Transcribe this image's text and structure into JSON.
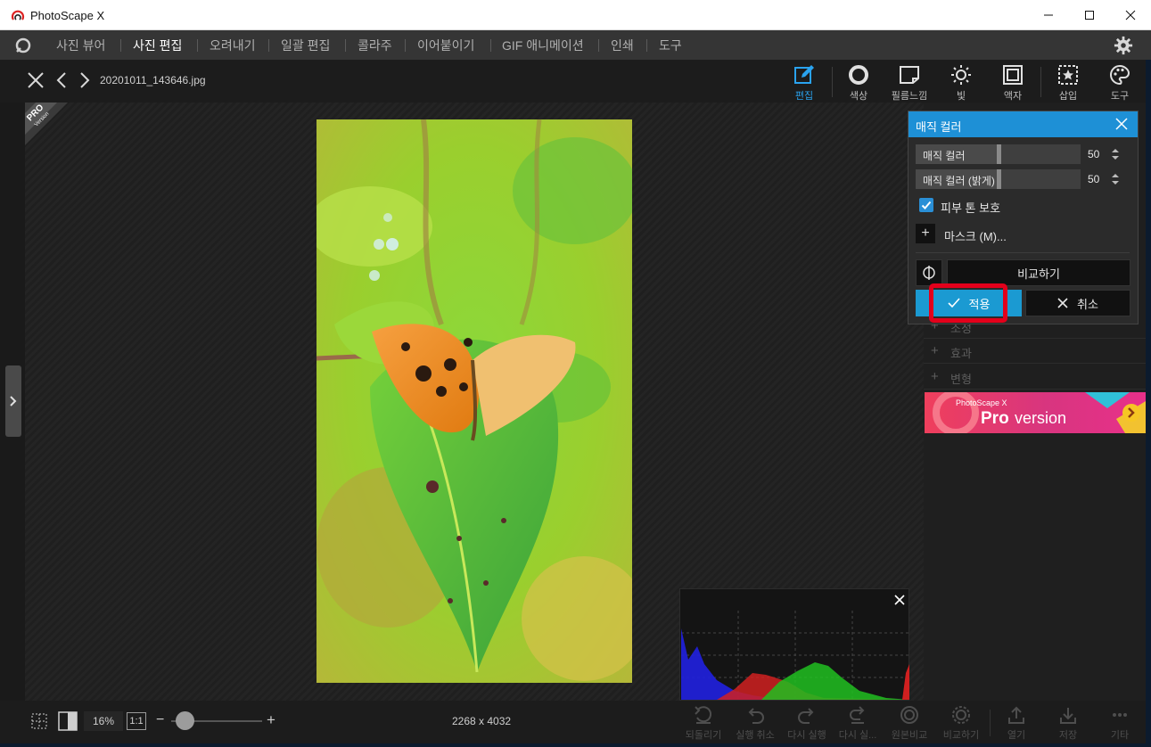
{
  "window": {
    "title": "PhotoScape X",
    "minimize_icon": "minimize-icon",
    "maximize_icon": "maximize-icon",
    "close_icon": "close-icon"
  },
  "menu": {
    "items": [
      {
        "label": "사진 뷰어",
        "active": false
      },
      {
        "label": "사진 편집",
        "active": true
      },
      {
        "label": "오려내기",
        "active": false
      },
      {
        "label": "일괄 편집",
        "active": false
      },
      {
        "label": "콜라주",
        "active": false
      },
      {
        "label": "이어붙이기",
        "active": false
      },
      {
        "label": "GIF 애니메이션",
        "active": false
      },
      {
        "label": "인쇄",
        "active": false
      },
      {
        "label": "도구",
        "active": false
      }
    ]
  },
  "editor": {
    "filename": "20201011_143646.jpg",
    "tools": [
      {
        "label": "편집",
        "icon": "edit-icon",
        "active": true
      },
      {
        "label": "색상",
        "icon": "color-circle-icon",
        "active": false
      },
      {
        "label": "필름느낌",
        "icon": "film-icon",
        "active": false
      },
      {
        "label": "빛",
        "icon": "sun-icon",
        "active": false
      },
      {
        "label": "액자",
        "icon": "frame-icon",
        "active": false
      },
      {
        "label": "삽입",
        "icon": "insert-star-icon",
        "active": false
      },
      {
        "label": "도구",
        "icon": "palette-icon",
        "active": false
      }
    ],
    "pro_badge": {
      "line1": "PRO",
      "line2": "Version"
    }
  },
  "dialog": {
    "title": "매직 컬러",
    "sliders": [
      {
        "label": "매직 컬러",
        "value": "50",
        "level": 0.5
      },
      {
        "label": "매직 컬러 (밝게)",
        "value": "50",
        "level": 0.5
      }
    ],
    "skin_tone": {
      "label": "피부 톤 보호",
      "checked": true
    },
    "mask": {
      "label": "마스크 (M)..."
    },
    "compare_label": "비교하기",
    "apply_label": "적용",
    "cancel_label": "취소"
  },
  "side_sections": [
    {
      "label": "조정"
    },
    {
      "label": "효과"
    },
    {
      "label": "변형"
    }
  ],
  "ad": {
    "small": "PhotoScape X",
    "big": "Pro",
    "rest": "version"
  },
  "bottom": {
    "zoom": "16%",
    "one_to_one": "1:1",
    "dimensions": "2268 x 4032",
    "actions": [
      {
        "label": "되돌리기",
        "icon": "revert-icon"
      },
      {
        "label": "실행 취소",
        "icon": "undo-icon"
      },
      {
        "label": "다시 실행",
        "icon": "redo-icon"
      },
      {
        "label": "다시 실...",
        "icon": "redo-all-icon"
      },
      {
        "label": "원본비교",
        "icon": "compare-original-icon"
      },
      {
        "label": "비교하기",
        "icon": "compare-icon"
      },
      {
        "label": "열기",
        "icon": "open-icon"
      },
      {
        "label": "저장",
        "icon": "save-icon"
      },
      {
        "label": "기타",
        "icon": "more-icon"
      }
    ]
  },
  "colors": {
    "accent": "#1e90d6",
    "apply": "#1b9ad2",
    "highlight": "#e3001b",
    "menubar": "#353535"
  }
}
